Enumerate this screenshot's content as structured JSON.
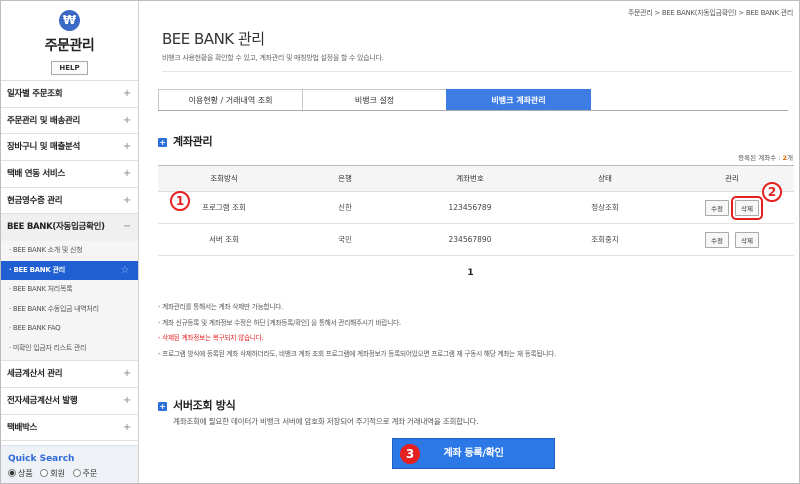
{
  "sidebar": {
    "logo_symbol": "₩",
    "title": "주문관리",
    "help": "HELP",
    "menu_top": [
      {
        "label": "일자별 주문조회"
      },
      {
        "label": "주문관리 및 배송관리"
      },
      {
        "label": "장바구니 및 매출분석"
      },
      {
        "label": "택배 연동 서비스"
      },
      {
        "label": "현금영수증 관리"
      }
    ],
    "open_menu": {
      "label": "BEE BANK(자동입금확인)",
      "toggle": "−"
    },
    "submenu": [
      {
        "label": "· BEE BANK 소개 및 신청"
      },
      {
        "label": "· BEE BANK 관리"
      },
      {
        "label": "· BEE BANK 처리목록"
      },
      {
        "label": "· BEE BANK 수동입금 내역처리"
      },
      {
        "label": "· BEE BANK FAQ"
      },
      {
        "label": "· 미확인 입금자 리스트 관리"
      }
    ],
    "menu_bottom": [
      {
        "label": "세금계산서 관리"
      },
      {
        "label": "전자세금계산서 발행"
      },
      {
        "label": "택배박스"
      }
    ],
    "plus": "+",
    "quick_search": {
      "title": "Quick Search",
      "options": [
        "상품",
        "회원",
        "주문"
      ]
    }
  },
  "breadcrumb": "주문관리 > BEE BANK(자동입금확인) > BEE BANK 관리",
  "page": {
    "title": "BEE BANK 관리",
    "description": "비뱅크 사용현황을 확인할 수 있고, 계좌관리 및 매칭방법 설정을 할 수 있습니다."
  },
  "tabs": [
    {
      "label": "이용현황 / 거래내역 조회",
      "active": false
    },
    {
      "label": "비뱅크 설정",
      "active": false
    },
    {
      "label": "비뱅크 계좌관리",
      "active": true
    }
  ],
  "account_section": {
    "title": "계좌관리",
    "count_prefix": "등록된 계좌수 : ",
    "count_value": "2",
    "count_suffix": "개",
    "columns": [
      "조회방식",
      "은행",
      "계좌번호",
      "상태",
      "관리"
    ],
    "rows": [
      {
        "method": "프로그램 조회",
        "bank": "신한",
        "number": "123456789",
        "status": "정상조회",
        "edit": "수정",
        "delete": "삭제"
      },
      {
        "method": "서버 조회",
        "bank": "국민",
        "number": "234567890",
        "status": "조회중지",
        "edit": "수정",
        "delete": "삭제"
      }
    ],
    "page": "1"
  },
  "notes": {
    "n1": "- 계좌관리를 통해서는 계좌 삭제만 가능합니다.",
    "n2": "- 계좌 신규등록 및 계좌정보 수정은 하단 [계좌등록/확인] 을 통해서 관리해주시기 바랍니다.",
    "n3": "- 삭제된 계좌정보는 복구되지 않습니다.",
    "n4": "- 프로그램 방식에 등록된 계좌 삭제하더라도, 비뱅크 계좌 조회 프로그램에 계좌정보가 등록되어있으면 프로그램 재 구동시 해당 계좌는 재 등록됩니다."
  },
  "server_section": {
    "title": "서버조회 방식",
    "description": "계좌조회에 필요한 데이터가 비뱅크 서버에 암호화 저장되어 주기적으로 계좌 거래내역을 조회합니다.",
    "button": "계좌 등록/확인"
  },
  "markers": {
    "m1": "1",
    "m2": "2",
    "m3": "3"
  },
  "colors": {
    "accent": "#2c78e6",
    "active_tab": "#3d7de3",
    "highlight": "#e52020",
    "warning": "#e52020"
  }
}
